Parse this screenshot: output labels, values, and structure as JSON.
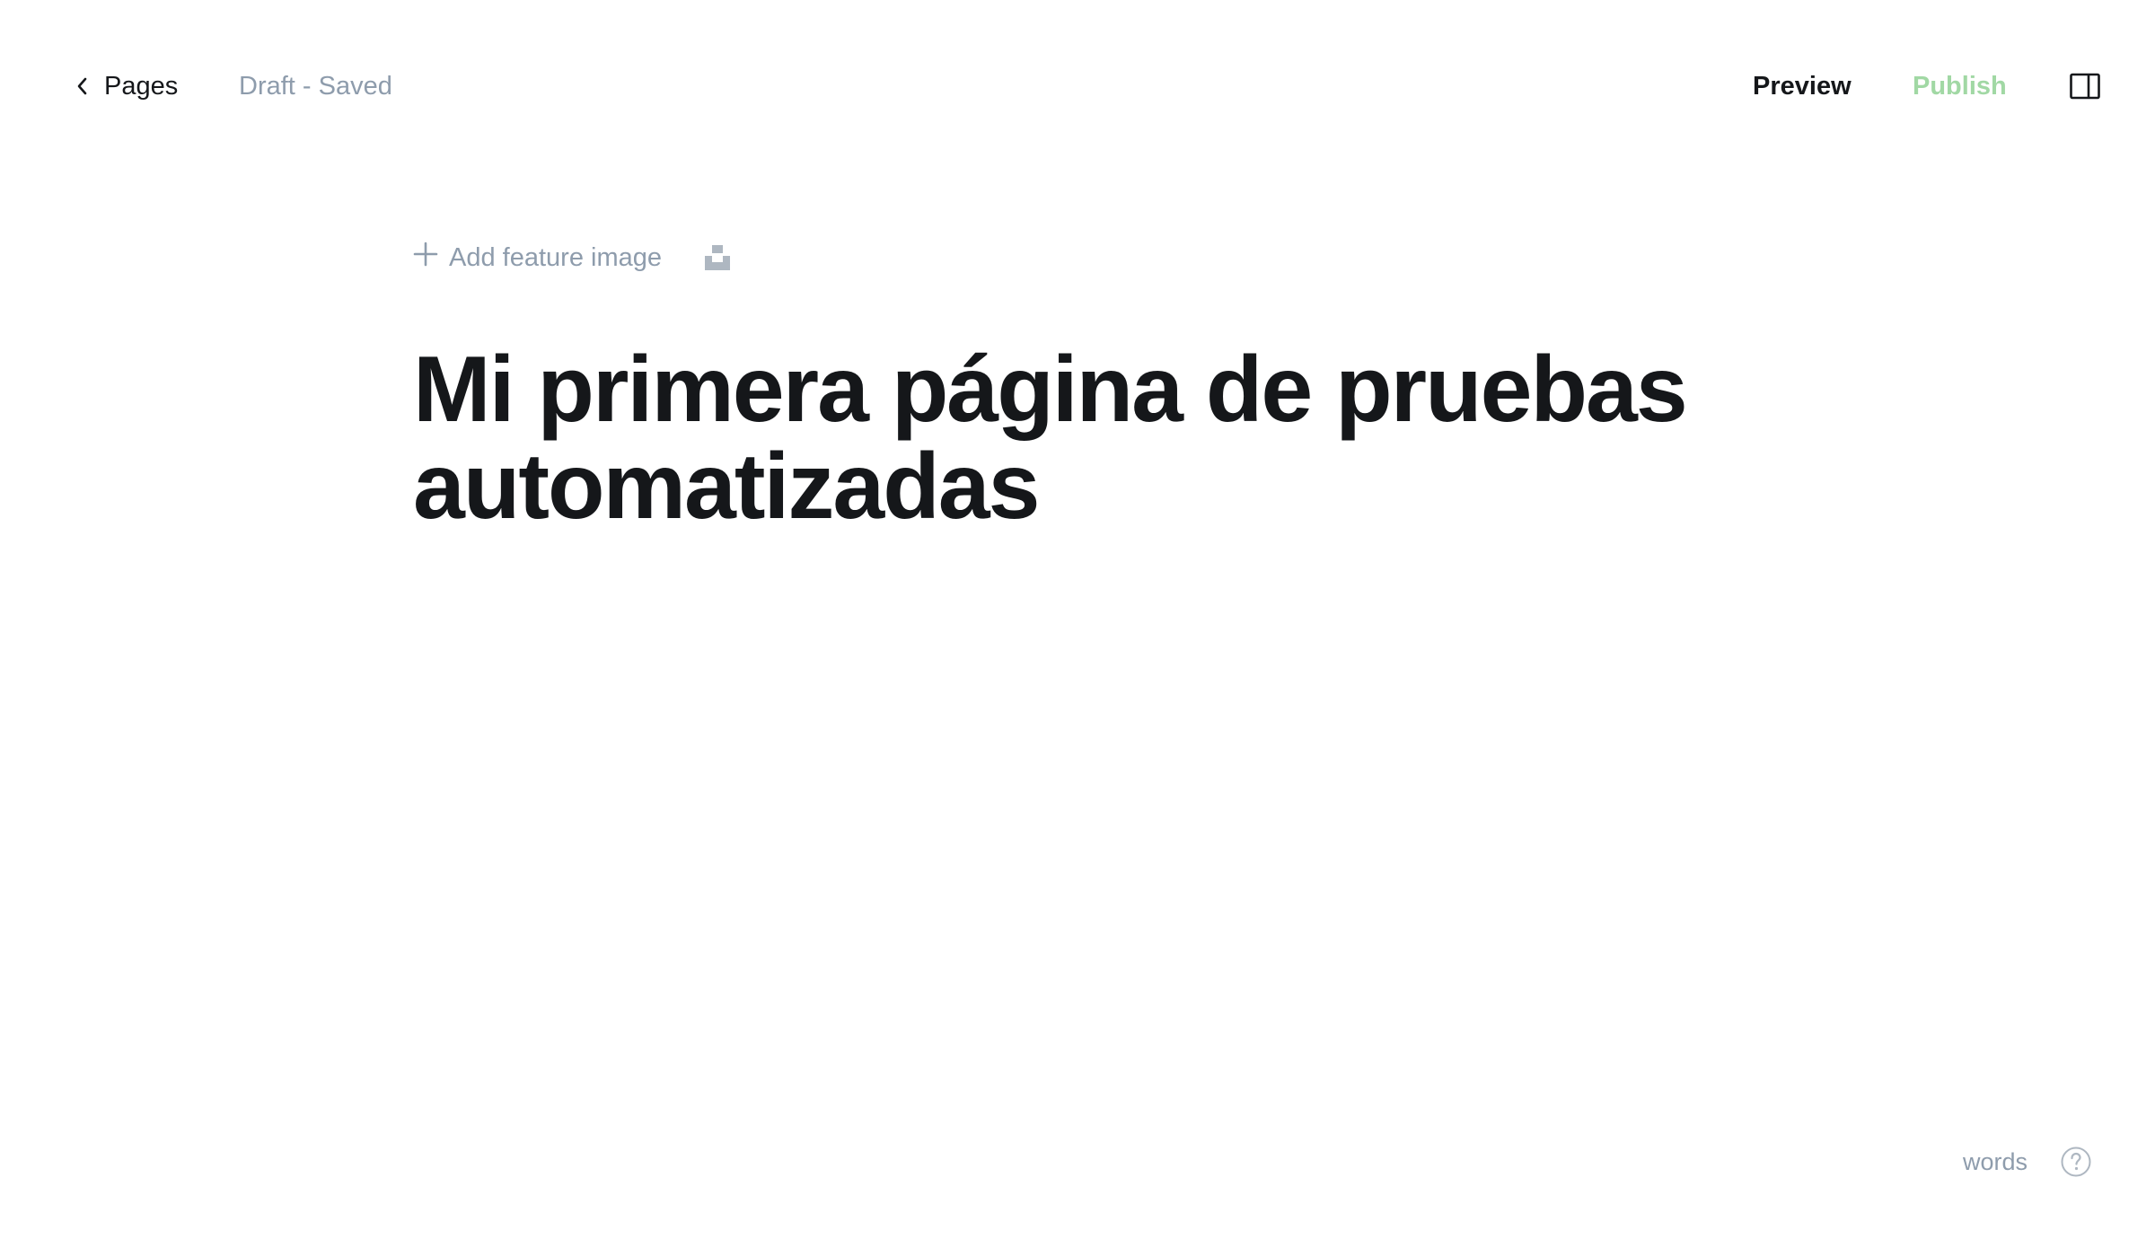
{
  "header": {
    "back_label": "Pages",
    "status": "Draft - Saved",
    "preview_label": "Preview",
    "publish_label": "Publish",
    "publish_color": "#a1d8a4"
  },
  "editor": {
    "add_feature_label": "Add feature image",
    "title": "Mi primera página de pruebas automatizadas"
  },
  "footer": {
    "words_label": "words"
  },
  "icons": {
    "back": "chevron-left-icon",
    "sidebar": "sidebar-toggle-icon",
    "add": "plus-icon",
    "unsplash": "unsplash-icon",
    "help": "help-icon"
  }
}
